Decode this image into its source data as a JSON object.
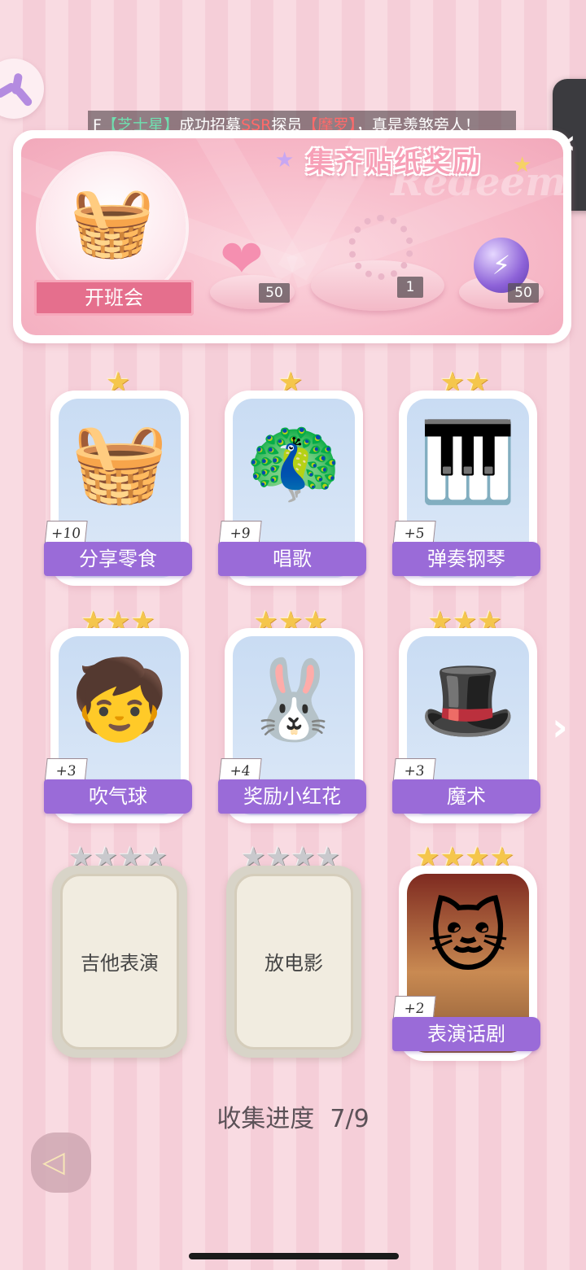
{
  "ticker": {
    "bracket_open": "【",
    "name": "芝士星",
    "text1": "成功招募",
    "rank": "SSR",
    "text2": "探员",
    "partner": "摩罗",
    "text3": "，真是羡煞旁人！",
    "lead": "F"
  },
  "banner": {
    "title": "集齐贴纸奖励",
    "watermark": "Redeem",
    "basket_label": "开班会",
    "rewards": [
      {
        "icon": "pink-heart-gem-icon",
        "count": "50"
      },
      {
        "icon": "crystal-bracelet-icon",
        "count": "1"
      },
      {
        "icon": "purple-lightning-orb-icon",
        "count": "50"
      }
    ]
  },
  "cards": [
    {
      "label": "分享零食",
      "bonus": "+10",
      "stars": "★",
      "icon": "snack-basket-icon",
      "unlocked": true
    },
    {
      "label": "唱歌",
      "bonus": "+9",
      "stars": "★",
      "icon": "singing-peacock-icon",
      "unlocked": true
    },
    {
      "label": "弹奏钢琴",
      "bonus": "+5",
      "stars": "★★",
      "icon": "piano-boy-icon",
      "unlocked": true
    },
    {
      "label": "吹气球",
      "bonus": "+3",
      "stars": "★★★",
      "icon": "bubble-boy-icon",
      "unlocked": true
    },
    {
      "label": "奖励小红花",
      "bonus": "+4",
      "stars": "★★★",
      "icon": "bunny-red-flower-icon",
      "unlocked": true
    },
    {
      "label": "魔术",
      "bonus": "+3",
      "stars": "★★★",
      "icon": "magician-girl-icon",
      "unlocked": true
    },
    {
      "label": "吉他表演",
      "stars": "★★★★",
      "icon": "",
      "unlocked": false
    },
    {
      "label": "放电影",
      "stars": "★★★★",
      "icon": "",
      "unlocked": false
    },
    {
      "label": "表演话剧",
      "bonus": "+2",
      "stars": "★★★★",
      "icon": "stage-cat-girl-icon",
      "unlocked": true
    }
  ],
  "progress": {
    "label": "收集进度",
    "value": "7/9"
  },
  "colors": {
    "accent_purple": "#9a6bd8",
    "banner_pink": "#f7b9c8",
    "gold_star": "#f5c64c"
  }
}
